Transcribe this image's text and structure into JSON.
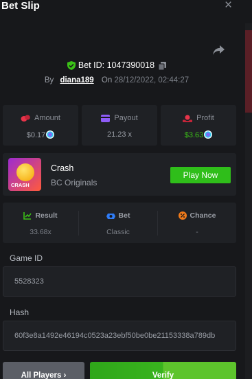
{
  "header": {
    "title": "Bet Slip",
    "close_label": "×"
  },
  "bet": {
    "id_label": "Bet ID: 1047390018",
    "by_label": "By",
    "username": "diana189",
    "on_label": "On",
    "datetime": "28/12/2022, 02:44:27"
  },
  "stats": [
    {
      "label": "Amount",
      "value": "$0.17",
      "value_color": "#9a9ea6",
      "icon": "coins-icon"
    },
    {
      "label": "Payout",
      "value": "21.23 x",
      "value_color": "#9a9ea6",
      "icon": "wallet-icon"
    },
    {
      "label": "Profit",
      "value": "$3.63",
      "value_color": "#3bc117",
      "icon": "profit-icon"
    }
  ],
  "game": {
    "thumbnail_text": "CRASH",
    "name": "Crash",
    "provider": "BC Originals",
    "play_label": "Play Now"
  },
  "result": [
    {
      "label": "Result",
      "value": "33.68x",
      "icon": "chart-icon",
      "icon_color": "#3bc117"
    },
    {
      "label": "Bet",
      "value": "Classic",
      "icon": "bet-icon",
      "icon_color": "#2f7cf6"
    },
    {
      "label": "Chance",
      "value": "-",
      "icon": "percent-icon",
      "icon_color": "#f07a1a"
    }
  ],
  "fields": {
    "game_id_label": "Game ID",
    "game_id_value": "5528323",
    "hash_label": "Hash",
    "hash_value": "60f3e8a1492e46194c0523a23ebf50be0be21153338a789db"
  },
  "footer": {
    "players_label": "All Players ›",
    "verify_label": "Verify"
  },
  "colors": {
    "accent_green": "#2fbe1a",
    "background": "#17181b",
    "card": "#1f2125"
  }
}
